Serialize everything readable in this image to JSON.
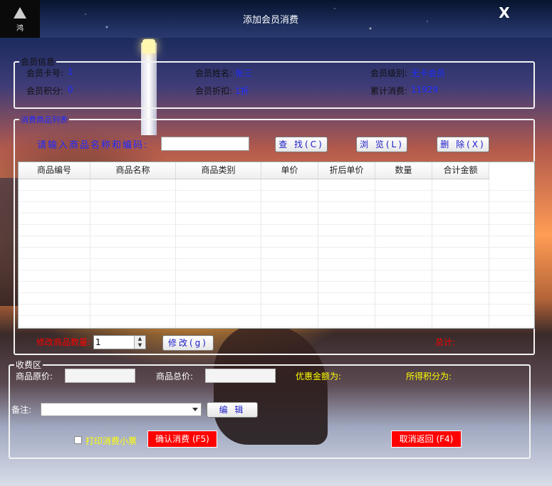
{
  "window": {
    "title": "添加会员消费",
    "close_label": "X",
    "logo_text": "鸿"
  },
  "member_info": {
    "legend": "会员信息",
    "card_no_label": "会员卡号:",
    "card_no": "1",
    "name_label": "会员姓名:",
    "name": "张三",
    "level_label": "会员级别:",
    "level": "无卡会员",
    "points_label": "会员积分:",
    "points": "0",
    "discount_label": "会员折扣:",
    "discount": "1折",
    "total_label": "累计消费:",
    "total": "11929"
  },
  "goods": {
    "legend": "消费商品列表",
    "search_prompt": "请输入商品名称和编码:",
    "search_value": "",
    "find_button": "查 找(C)",
    "browse_button": "浏 览(L)",
    "delete_button": "删 除(X)",
    "columns": [
      "商品编号",
      "商品名称",
      "商品类别",
      "单价",
      "折后单价",
      "数量",
      "合计金额"
    ],
    "qty_label": "修改商品数量:",
    "qty_value": "1",
    "modify_button": "修改(g)",
    "total_label": "总计:"
  },
  "payment": {
    "legend": "收费区",
    "original_price_label": "商品原价:",
    "total_price_label": "商品总价:",
    "discount_amount_label": "优惠金额为:",
    "points_earned_label": "所得积分为:",
    "remark_label": "备注:",
    "edit_button": "编 辑",
    "print_receipt_label": "打印消费小票",
    "confirm_button": "确认消费 (F5)",
    "cancel_button": "取消返回 (F4)"
  },
  "colors": {
    "value_blue": "#1e2aff",
    "label_yellow": "#ffff00",
    "red": "#ff0000"
  }
}
